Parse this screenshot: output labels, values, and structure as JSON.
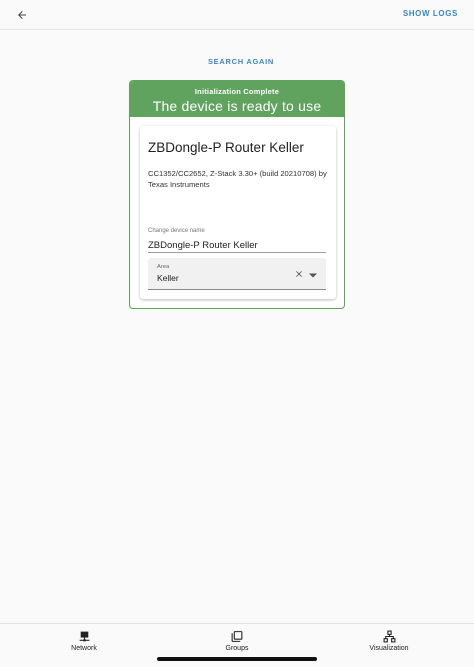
{
  "topbar": {
    "back_icon": "arrow-left-icon",
    "show_logs_label": "SHOW LOGS"
  },
  "search_again_label": "SEARCH AGAIN",
  "status": {
    "subtitle": "Initialization Complete",
    "title": "The device is ready to use",
    "color": "#5fa35f"
  },
  "device": {
    "name": "ZBDongle-P Router Keller",
    "description": "CC1352/CC2652, Z-Stack 3.30+ (build 20210708) by Texas Instruments"
  },
  "form": {
    "name_label": "Change device name",
    "name_value": "ZBDongle-P Router Keller",
    "area_label": "Area",
    "area_value": "Keller",
    "clear_icon": "close-icon",
    "dropdown_icon": "caret-down-icon"
  },
  "nav": {
    "items": [
      {
        "label": "Network",
        "icon": "network-icon"
      },
      {
        "label": "Groups",
        "icon": "groups-icon"
      },
      {
        "label": "Visualization",
        "icon": "hub-icon"
      }
    ]
  },
  "colors": {
    "accent": "#3d86c6",
    "success": "#5fa35f"
  }
}
